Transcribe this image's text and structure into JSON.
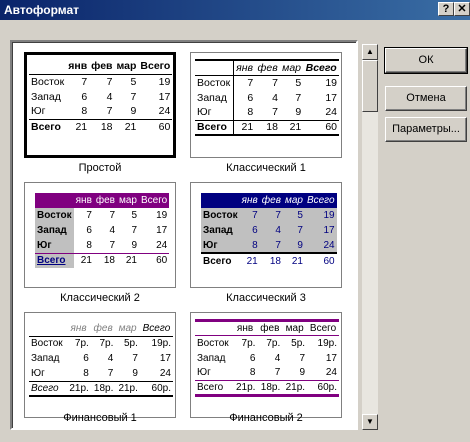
{
  "window": {
    "title": "Автоформат",
    "help_glyph": "?",
    "close_glyph": "✕"
  },
  "buttons": {
    "ok": "ОК",
    "cancel": "Отмена",
    "options": "Параметры..."
  },
  "scroll": {
    "up_glyph": "▲",
    "down_glyph": "▼"
  },
  "formats": [
    {
      "name": "Простой",
      "cols": [
        "янв",
        "фев",
        "мар",
        "Всего"
      ],
      "rows": [
        [
          "Восток",
          "7",
          "7",
          "5",
          "19"
        ],
        [
          "Запад",
          "6",
          "4",
          "7",
          "17"
        ],
        [
          "Юг",
          "8",
          "7",
          "9",
          "24"
        ],
        [
          "Всего",
          "21",
          "18",
          "21",
          "60"
        ]
      ]
    },
    {
      "name": "Классический 1",
      "cols": [
        "янв",
        "фев",
        "мар",
        "Всего"
      ],
      "rows": [
        [
          "Восток",
          "7",
          "7",
          "5",
          "19"
        ],
        [
          "Запад",
          "6",
          "4",
          "7",
          "17"
        ],
        [
          "Юг",
          "8",
          "7",
          "9",
          "24"
        ],
        [
          "Всего",
          "21",
          "18",
          "21",
          "60"
        ]
      ]
    },
    {
      "name": "Классический 2",
      "cols": [
        "янв",
        "фев",
        "мар",
        "Всего"
      ],
      "rows": [
        [
          "Восток",
          "7",
          "7",
          "5",
          "19"
        ],
        [
          "Запад",
          "6",
          "4",
          "7",
          "17"
        ],
        [
          "Юг",
          "8",
          "7",
          "9",
          "24"
        ],
        [
          "Всего",
          "21",
          "18",
          "21",
          "60"
        ]
      ]
    },
    {
      "name": "Классический 3",
      "cols": [
        "янв",
        "фев",
        "мар",
        "Всего"
      ],
      "rows": [
        [
          "Восток",
          "7",
          "7",
          "5",
          "19"
        ],
        [
          "Запад",
          "6",
          "4",
          "7",
          "17"
        ],
        [
          "Юг",
          "8",
          "7",
          "9",
          "24"
        ],
        [
          "Всего",
          "21",
          "18",
          "21",
          "60"
        ]
      ]
    },
    {
      "name": "Финансовый 1",
      "cols": [
        "янв",
        "фев",
        "мар",
        "Всего"
      ],
      "rows": [
        [
          "Восток",
          "7р.",
          "7р.",
          "5р.",
          "19р."
        ],
        [
          "Запад",
          "6",
          "4",
          "7",
          "17"
        ],
        [
          "Юг",
          "8",
          "7",
          "9",
          "24"
        ],
        [
          "Всего",
          "21р.",
          "18р.",
          "21р.",
          "60р."
        ]
      ]
    },
    {
      "name": "Финансовый 2",
      "cols": [
        "янв",
        "фев",
        "мар",
        "Всего"
      ],
      "rows": [
        [
          "Восток",
          "7р.",
          "7р.",
          "5р.",
          "19р."
        ],
        [
          "Запад",
          "6",
          "4",
          "7",
          "17"
        ],
        [
          "Юг",
          "8",
          "7",
          "9",
          "24"
        ],
        [
          "Всего",
          "21р.",
          "18р.",
          "21р.",
          "60р."
        ]
      ]
    }
  ],
  "colors": {
    "titlebar": "#0a246a",
    "classic2_header": "#800080",
    "classic2_rows": "#c0c0c0",
    "classic3_header": "#000080",
    "classic3_text": "#000080",
    "fin2_rule": "#800080"
  }
}
